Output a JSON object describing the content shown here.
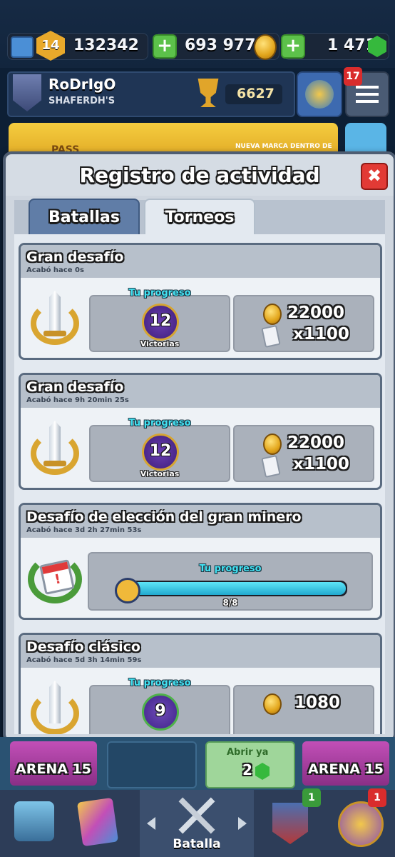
{
  "top_bar": {
    "level": "14",
    "experience": "132342",
    "gold": "693 977",
    "gems": "1 471",
    "plus_label": "+"
  },
  "player": {
    "name": "RoDrIgO",
    "clan": "SHAFERDH'S",
    "trophies": "6627",
    "notification_count": "17"
  },
  "banner": {
    "left_text": "PASS",
    "right_text": "NUEVA MARCA DENTRO DE"
  },
  "modal": {
    "title": "Registro de actividad",
    "close_label": "✖",
    "tabs": [
      {
        "label": "Batallas",
        "active": false
      },
      {
        "label": "Torneos",
        "active": true
      }
    ],
    "entries": [
      {
        "title": "Gran desafío",
        "subtitle": "Acabó hace 0s",
        "progress_label": "Tu progreso",
        "wins": "12",
        "wins_label": "Victorias",
        "gold": "22000",
        "cards": "x1100"
      },
      {
        "title": "Gran desafío",
        "subtitle": "Acabó hace 9h 20min  25s",
        "progress_label": "Tu progreso",
        "wins": "12",
        "wins_label": "Victorias",
        "gold": "22000",
        "cards": "x1100"
      },
      {
        "title": "Desafío de elección del gran minero",
        "subtitle": "Acabó hace 3d 2h 27min  53s",
        "progress_label": "Tu progreso",
        "progress_text": "8/8",
        "progress_fraction": 1.0
      },
      {
        "title": "Desafío clásico",
        "subtitle": "Acabó hace 5d 3h 14min  59s",
        "progress_label": "Tu progreso",
        "wins": "9",
        "gold": "1080"
      }
    ]
  },
  "chest_slots": {
    "left_arena": "ARENA 15",
    "open_now": "Abrir ya",
    "open_cost": "2",
    "right_arena": "ARENA 15"
  },
  "bottom_nav": {
    "battle_label": "Batalla",
    "clan_badge": "1",
    "events_badge": "1"
  },
  "colors": {
    "accent_cyan": "#43e2f2",
    "close_red": "#e23a35",
    "plus_green": "#5cc14a",
    "gold": "#f0b93a"
  }
}
